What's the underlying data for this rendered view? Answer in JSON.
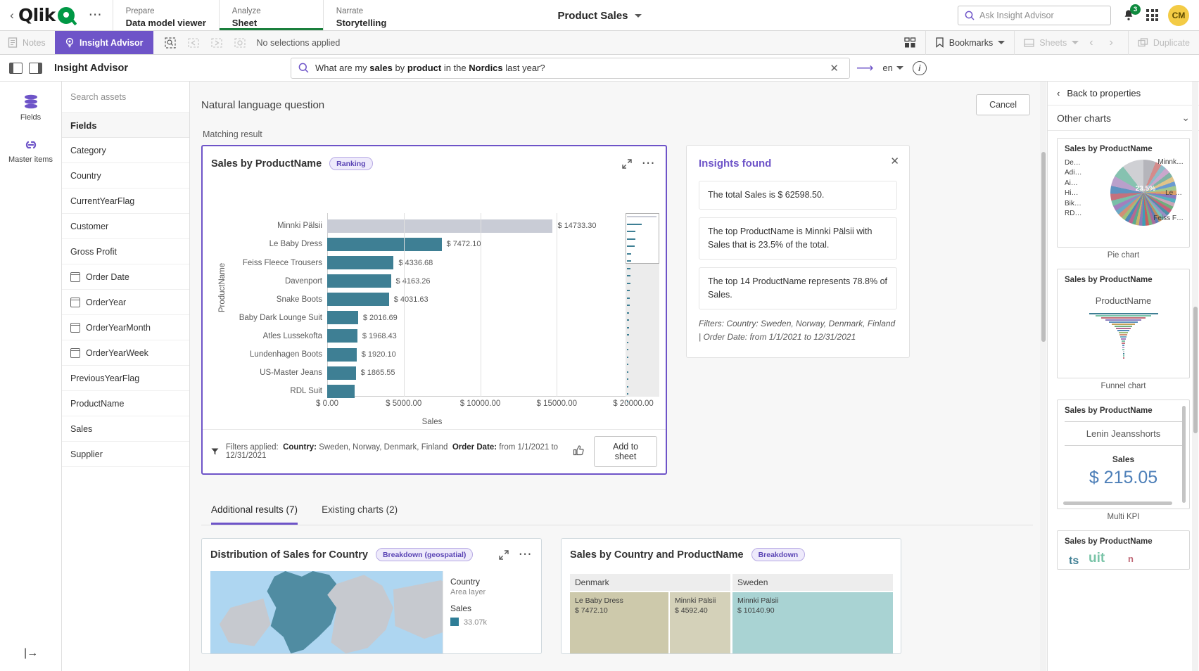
{
  "topbar": {
    "back_icon": "chevron-left-icon",
    "brand": "Qlik",
    "menu": [
      {
        "section": "Prepare",
        "label": "Data model viewer",
        "active": false
      },
      {
        "section": "Analyze",
        "label": "Sheet",
        "active": true
      },
      {
        "section": "Narrate",
        "label": "Storytelling",
        "active": false
      }
    ],
    "app_title": "Product Sales",
    "ask_placeholder": "Ask Insight Advisor",
    "notification_count": "3",
    "avatar_initials": "CM"
  },
  "toolbar": {
    "notes": "Notes",
    "insight_advisor": "Insight Advisor",
    "selections_status": "No selections applied",
    "bookmarks": "Bookmarks",
    "sheets": "Sheets",
    "duplicate": "Duplicate"
  },
  "ia_header": {
    "title": "Insight Advisor",
    "query_parts": [
      {
        "t": "What are my ",
        "b": false
      },
      {
        "t": "sales",
        "b": true
      },
      {
        "t": " by ",
        "b": false
      },
      {
        "t": "product",
        "b": true
      },
      {
        "t": " in the ",
        "b": false
      },
      {
        "t": "Nordics",
        "b": true
      },
      {
        "t": " last year?",
        "b": false
      }
    ],
    "query_plain": "What are my sales by product in the Nordics last year?",
    "language": "en"
  },
  "rail": [
    {
      "label": "Fields",
      "icon": "database-icon"
    },
    {
      "label": "Master items",
      "icon": "link-icon"
    }
  ],
  "assets": {
    "search_placeholder": "Search assets",
    "header": "Fields",
    "fields": [
      {
        "name": "Category",
        "date": false
      },
      {
        "name": "Country",
        "date": false
      },
      {
        "name": "CurrentYearFlag",
        "date": false
      },
      {
        "name": "Customer",
        "date": false
      },
      {
        "name": "Gross Profit",
        "date": false
      },
      {
        "name": "Order Date",
        "date": true
      },
      {
        "name": "OrderYear",
        "date": true
      },
      {
        "name": "OrderYearMonth",
        "date": true
      },
      {
        "name": "OrderYearWeek",
        "date": true
      },
      {
        "name": "PreviousYearFlag",
        "date": false
      },
      {
        "name": "ProductName",
        "date": false
      },
      {
        "name": "Sales",
        "date": false
      },
      {
        "name": "Supplier",
        "date": false
      }
    ]
  },
  "main": {
    "nlq_title": "Natural language question",
    "cancel": "Cancel",
    "matching_result": "Matching result",
    "chart": {
      "title": "Sales by ProductName",
      "badge": "Ranking",
      "footer_prefix": "Filters applied:",
      "footer_country_label": "Country:",
      "footer_country_value": "Sweden, Norway, Denmark, Finland",
      "footer_date_label": "Order Date:",
      "footer_date_value": "from 1/1/2021 to 12/31/2021",
      "add_to_sheet": "Add to sheet"
    },
    "insights": {
      "title": "Insights found",
      "items": [
        "The total Sales is $ 62598.50.",
        "The top ProductName is Minnki Pälsii with Sales that is 23.5% of the total.",
        "The top 14 ProductName represents 78.8% of Sales."
      ],
      "filters": "Filters: Country: Sweden, Norway, Denmark, Finland | Order Date: from 1/1/2021 to 12/31/2021"
    },
    "tabs": [
      {
        "label": "Additional results (7)",
        "active": true
      },
      {
        "label": "Existing charts (2)",
        "active": false
      }
    ],
    "card_map": {
      "title": "Distribution of Sales for Country",
      "badge": "Breakdown (geospatial)",
      "legend_country": "Country",
      "legend_area": "Area layer",
      "legend_sales": "Sales",
      "legend_value": "33.07k"
    },
    "card_tree": {
      "title": "Sales by Country and ProductName",
      "badge": "Breakdown",
      "columns": [
        {
          "header": "Denmark",
          "cells": [
            {
              "name": "Le Baby Dress",
              "value": "$ 7472.10"
            },
            {
              "name": "Minnki Pälsii",
              "value": "$ 4592.40"
            }
          ]
        },
        {
          "header": "Sweden",
          "cells": [
            {
              "name": "Minnki Pälsii",
              "value": "$ 10140.90"
            }
          ]
        }
      ]
    }
  },
  "right_panel": {
    "back": "Back to properties",
    "section": "Other charts",
    "thumbs": [
      {
        "title": "Sales by ProductName",
        "caption": "Pie chart",
        "pct": "23.5%",
        "labels_left": [
          "De…",
          "Adi…",
          "Ai…",
          "Hi…",
          "Bik…",
          "RD…"
        ],
        "labels_right": [
          "Minnk…",
          "Le …",
          "Feiss F…"
        ]
      },
      {
        "title": "Sales by ProductName",
        "caption": "Funnel chart",
        "dim": "ProductName"
      },
      {
        "title": "Sales by ProductName",
        "caption": "Multi KPI",
        "kpi_name": "Lenin Jeansshorts",
        "kpi_label": "Sales",
        "kpi_value": "$ 215.05"
      },
      {
        "title": "Sales by ProductName",
        "caption": ""
      }
    ]
  },
  "chart_data": {
    "type": "bar",
    "title": "Sales by ProductName",
    "xlabel": "Sales",
    "ylabel": "ProductName",
    "orientation": "horizontal",
    "xlim": [
      0,
      20000
    ],
    "xticks": [
      "$ 0.00",
      "$ 5000.00",
      "$ 10000.00",
      "$ 15000.00",
      "$ 20000.00"
    ],
    "xtick_values": [
      0,
      5000,
      10000,
      15000,
      20000
    ],
    "grid": true,
    "categories": [
      "Minnki Pälsii",
      "Le Baby Dress",
      "Feiss Fleece Trousers",
      "Davenport",
      "Snake Boots",
      "Baby Dark Lounge Suit",
      "Atles Lussekofta",
      "Lundenhagen Boots",
      "US-Master Jeans",
      "RDL Suit"
    ],
    "values": [
      14733.3,
      7472.1,
      4336.68,
      4163.26,
      4031.63,
      2016.69,
      1968.43,
      1920.1,
      1865.55,
      1800.0
    ],
    "value_labels": [
      "$ 14733.30",
      "$ 7472.10",
      "$ 4336.68",
      "$ 4163.26",
      "$ 4031.63",
      "$ 2016.69",
      "$ 1968.43",
      "$ 1920.10",
      "$ 1865.55",
      ""
    ],
    "bar_color": "#3e7f94",
    "highlight_color": "#c9ccd6",
    "highlight_index": 0,
    "total_sales": 62598.5
  }
}
